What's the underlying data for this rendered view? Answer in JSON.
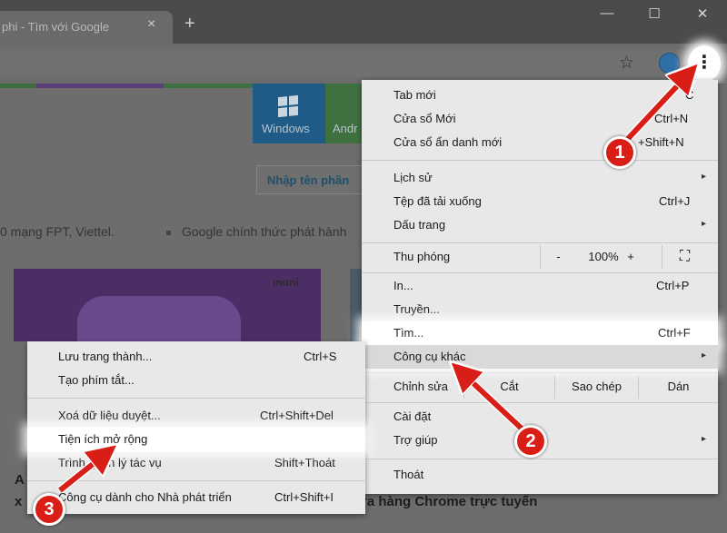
{
  "tab": {
    "title": "phi - Tìm với Google",
    "close_icon": "×",
    "new_tab_icon": "+"
  },
  "window": {
    "minimize": "—",
    "maximize": "☐",
    "close": "✕"
  },
  "toolbar": {
    "star_icon": "☆",
    "menu_icon": "⋮"
  },
  "page": {
    "category_windows": "Windows",
    "category_android": "Andr",
    "search_placeholder": "Nhập tên phần",
    "news_left": "0 mạng FPT, Viettel.",
    "news_right": "Google chính thức phát hành",
    "thumb_logo": "moni",
    "bold_left_1": "A",
    "bold_left_2": "x",
    "bold_right": "ra hàng Chrome trực tuyến"
  },
  "main_menu": {
    "new_tab": "Tab mới",
    "new_tab_sc": "C",
    "new_window": "Cửa sổ Mới",
    "new_window_sc": "Ctrl+N",
    "incognito": "Cửa sổ ẩn danh mới",
    "incognito_sc": "+Shift+N",
    "history": "Lịch sử",
    "downloads": "Tệp đã tải xuống",
    "downloads_sc": "Ctrl+J",
    "bookmarks": "Dấu trang",
    "zoom": "Thu phóng",
    "zoom_minus": "-",
    "zoom_value": "100%",
    "zoom_plus": "+",
    "fullscreen_icon": "⛶",
    "print": "In...",
    "print_sc": "Ctrl+P",
    "cast": "Truyền...",
    "find": "Tìm...",
    "find_sc": "Ctrl+F",
    "more_tools": "Công cụ khác",
    "edit": "Chỉnh sửa",
    "cut": "Cắt",
    "copy": "Sao chép",
    "paste": "Dán",
    "settings": "Cài đặt",
    "help": "Trợ giúp",
    "exit": "Thoát",
    "submenu_arrow": "▸"
  },
  "sub_menu": {
    "save_page": "Lưu trang thành...",
    "save_page_sc": "Ctrl+S",
    "create_shortcut": "Tạo phím tắt...",
    "clear_data": "Xoá dữ liệu duyệt...",
    "clear_data_sc": "Ctrl+Shift+Del",
    "extensions": "Tiện ích mở rộng",
    "task_manager": "Trình quản lý tác vụ",
    "task_manager_sc": "Shift+Thoát",
    "dev_tools": "Công cụ dành cho Nhà phát triển",
    "dev_tools_sc": "Ctrl+Shift+I"
  },
  "badges": {
    "one": "1",
    "two": "2",
    "three": "3"
  },
  "colors": {
    "annotation_red": "#d81e16",
    "menu_bg": "#e8e8e8"
  }
}
